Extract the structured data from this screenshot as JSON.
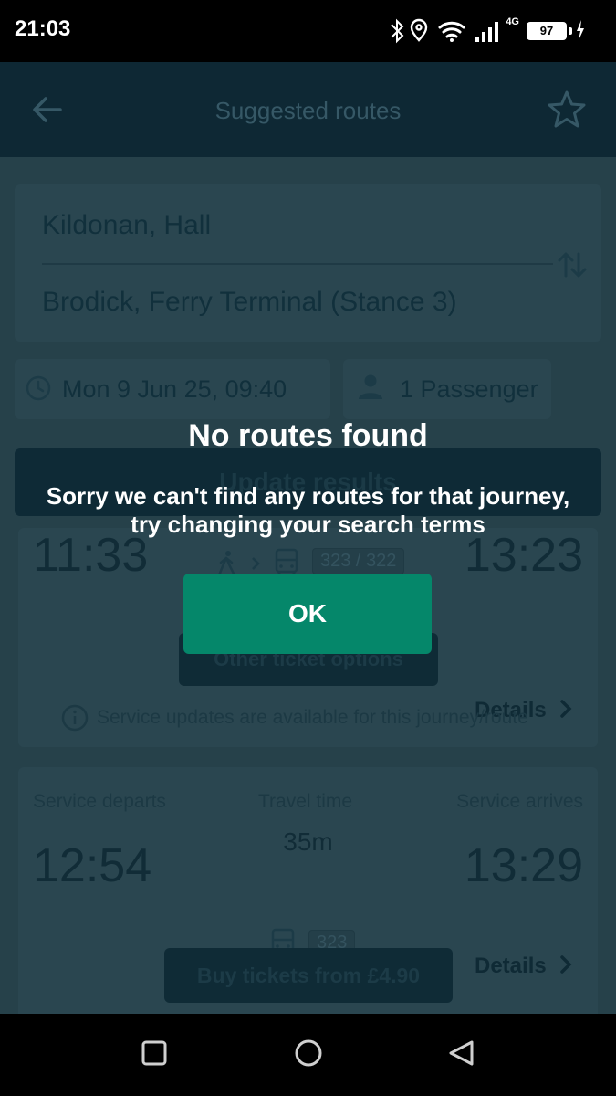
{
  "status_bar": {
    "time": "21:03",
    "network": "4G",
    "battery": "97",
    "icons": [
      "bluetooth-icon",
      "location-icon",
      "wifi-icon",
      "signal-icon",
      "battery-icon",
      "charging-icon"
    ]
  },
  "app_bar": {
    "title": "Suggested routes",
    "back_icon": "arrow-left-icon",
    "favourite_icon": "star-outline-icon"
  },
  "search": {
    "from": "Kildonan, Hall",
    "to": "Brodick, Ferry Terminal (Stance 3)",
    "swap_icon": "swap-vertical-icon",
    "date_time": "Mon 9 Jun 25, 09:40",
    "passengers": "1 Passenger",
    "update_button": "Update results"
  },
  "journeys": [
    {
      "departs": "11:33",
      "arrives": "13:23",
      "services": "323 / 322",
      "other_button": "Other ticket options",
      "details": "Details",
      "notice": "Service updates are available for this journey/route"
    },
    {
      "departs_label": "Service departs",
      "travel_label": "Travel time",
      "arrives_label": "Service arrives",
      "departs": "12:54",
      "duration": "35m",
      "arrives": "13:29",
      "service": "323",
      "buy_button": "Buy tickets from £4.90",
      "details": "Details"
    }
  ],
  "dialog": {
    "title": "No routes found",
    "message": "Sorry we can't find any routes for that journey, try changing your search terms",
    "ok_button": "OK"
  },
  "nav_bar": {
    "buttons": [
      "recent-apps-icon",
      "home-icon",
      "back-triangle-icon"
    ]
  },
  "colors": {
    "accent": "#05876a",
    "app_bar": "#0e2834",
    "overlay_background": "#26414a"
  }
}
